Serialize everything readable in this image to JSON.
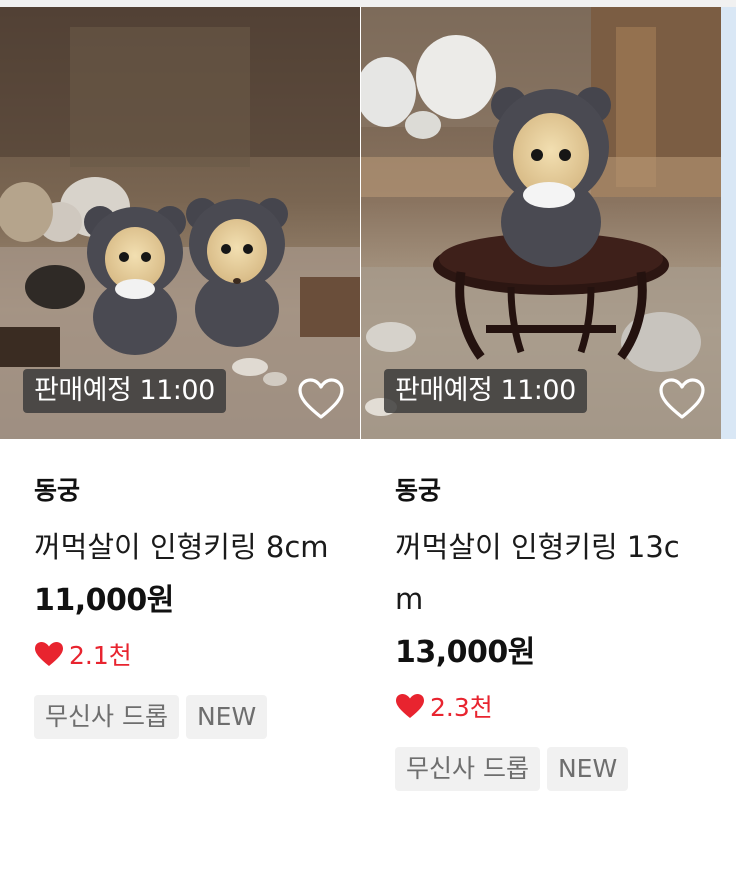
{
  "products": [
    {
      "sale_badge": "판매예정 11:00",
      "brand": "동궁",
      "title": "꺼먹살이 인형키링 8cm",
      "price": "11,000원",
      "likes": "2.1천",
      "tags": [
        "무신사 드롭",
        "NEW"
      ]
    },
    {
      "sale_badge": "판매예정 11:00",
      "brand": "동궁",
      "title": "꺼먹살이 인형키링 13cm",
      "price": "13,000원",
      "likes": "2.3천",
      "tags": [
        "무신사 드롭",
        "NEW"
      ]
    }
  ],
  "colors": {
    "like_red": "#e8242f",
    "badge_bg": "#3a3a3a",
    "tag_bg": "#f1f1f1"
  },
  "icons": {
    "wishlist": "heart-outline-icon",
    "likes": "heart-filled-icon"
  }
}
